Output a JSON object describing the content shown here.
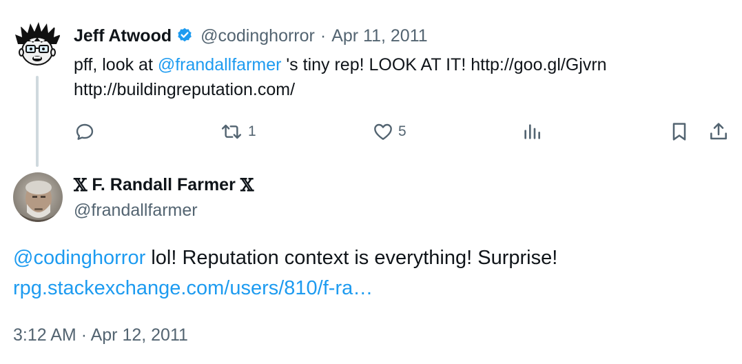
{
  "parent_tweet": {
    "author_name": "Jeff Atwood",
    "author_handle": "@codinghorror",
    "separator": "·",
    "date": "Apr 11, 2011",
    "text_before": "pff, look at ",
    "mention": "@frandallfarmer",
    "text_after": " 's tiny rep! LOOK AT IT! http://goo.gl/Gjvrn http://buildingreputation.com/",
    "retweet_count": "1",
    "like_count": "5",
    "avatar_icon": "cartoon-avatar-icon",
    "verified_icon": "verified-badge-icon",
    "verified_color": "#1d9bf0"
  },
  "main_tweet": {
    "name_prefix": "𝕏",
    "author_name": "F. Randall Farmer",
    "name_suffix": "𝕏",
    "author_handle": "@frandallfarmer",
    "mention": "@codinghorror",
    "text": " lol! Reputation context is everything! Surprise!",
    "link": "rpg.stackexchange.com/users/810/f-ra…",
    "time": "3:12 AM",
    "separator": "·",
    "date": "Apr 12, 2011",
    "avatar_icon": "photo-avatar-icon"
  },
  "colors": {
    "link": "#1d9bf0",
    "secondary_text": "#536471",
    "primary_text": "#0f1419",
    "thread_line": "#cfd9de"
  }
}
